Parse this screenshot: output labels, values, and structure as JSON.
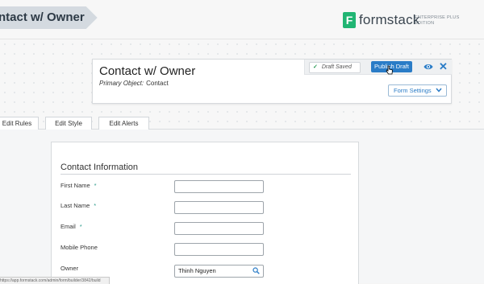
{
  "header": {
    "breadcrumb": "ntact w/ Owner",
    "brand_mark": "F",
    "brand_name": "formstack",
    "edition_line1": "ENTERPRISE PLUS",
    "edition_line2": "EDITION"
  },
  "form_card": {
    "title": "Contact w/ Owner",
    "primary_object_label": "Primary Object:",
    "primary_object_value": "Contact",
    "draft_status": "Draft Saved",
    "publish_label": "Publish Draft",
    "settings_label": "Form Settings"
  },
  "tabs": [
    {
      "label": "Edit Rules"
    },
    {
      "label": "Edit Style"
    },
    {
      "label": "Edit Alerts"
    }
  ],
  "form": {
    "section_title": "Contact Information",
    "fields": [
      {
        "label": "First Name",
        "required": "*",
        "value": ""
      },
      {
        "label": "Last Name",
        "required": "*",
        "value": ""
      },
      {
        "label": "Email",
        "required": "*",
        "value": ""
      },
      {
        "label": "Mobile Phone",
        "required": "",
        "value": ""
      },
      {
        "label": "Owner",
        "required": "",
        "value": "Thinh Nguyen"
      }
    ]
  },
  "status_bar": {
    "url": "https://app.formstack.com/admin/form/builder/3842/build"
  },
  "colors": {
    "accent_blue": "#2a7cc7",
    "brand_green": "#21b573",
    "required_teal": "#2a9a8a"
  },
  "icons": [
    "check-icon",
    "eye-icon",
    "close-icon",
    "chevron-down-icon",
    "search-icon",
    "pointer-cursor-icon"
  ]
}
